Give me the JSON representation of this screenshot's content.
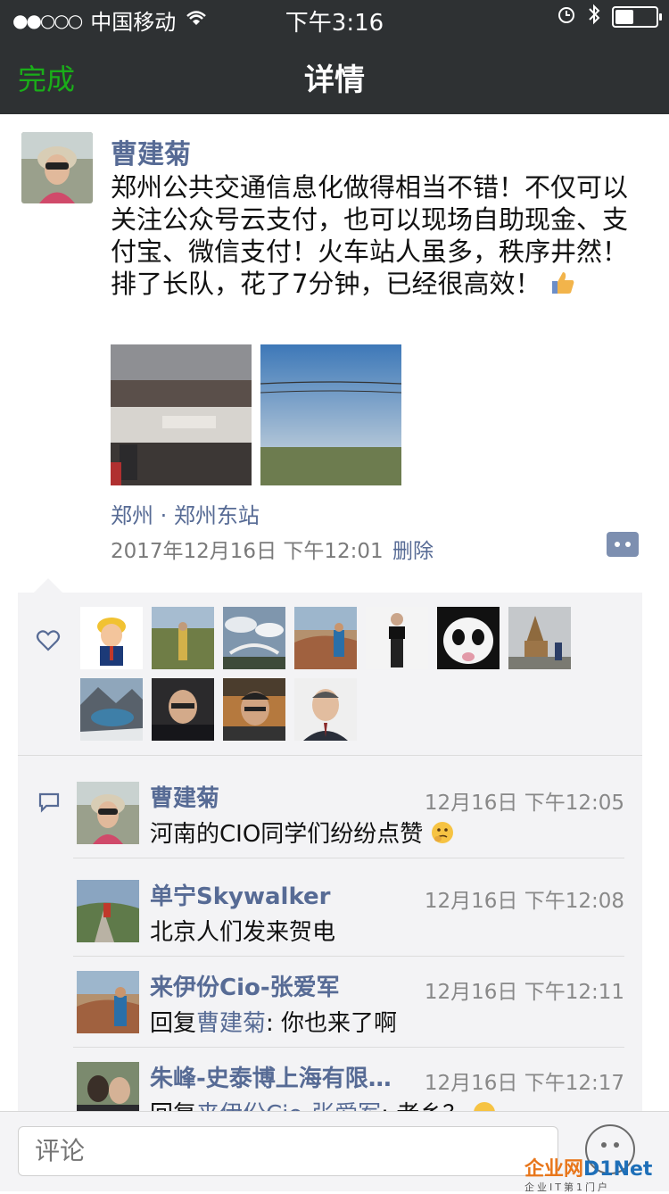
{
  "status_bar": {
    "signal": "●●○○○",
    "carrier": "中国移动",
    "time": "下午3:16",
    "battery_level": 0.45
  },
  "nav": {
    "done_label": "完成",
    "title": "详情"
  },
  "post": {
    "author": "曹建菊",
    "text": "郑州公共交通信息化做得相当不错！不仅可以关注公众号云支付，也可以现场自助现金、支付宝、微信支付！火车站人虽多，秩序井然！排了长队，花了7分钟，已经很高效！",
    "location": "郑州 · 郑州东站",
    "timestamp": "2017年12月16日 下午12:01",
    "delete_label": "删除"
  },
  "comments": [
    {
      "name": "曹建菊",
      "time": "12月16日 下午12:05",
      "text": "河南的CIO同学们纷纷点赞"
    },
    {
      "name": "单宁Skywalker",
      "time": "12月16日 下午12:08",
      "text": "北京人们发来贺电"
    },
    {
      "name": "来伊份Cio-张爱军",
      "time": "12月16日 下午12:11",
      "reply_prefix": "回复",
      "reply_to": "曹建菊",
      "text": ": 你也来了啊"
    },
    {
      "name": "朱峰-史泰博上海有限…",
      "time": "12月16日 下午12:17",
      "reply_prefix": "回复",
      "reply_to": "来伊份Cio-张爱军",
      "text": ": 老乡？"
    }
  ],
  "bottom": {
    "comment_placeholder": "评论"
  },
  "watermark": {
    "main_a": "企业网",
    "main_b": "D1Net",
    "sub": "企业IT第1门户"
  },
  "colors": {
    "accent_green": "#1aad19",
    "link_blue": "#576b95",
    "topbar": "#2e3133"
  }
}
